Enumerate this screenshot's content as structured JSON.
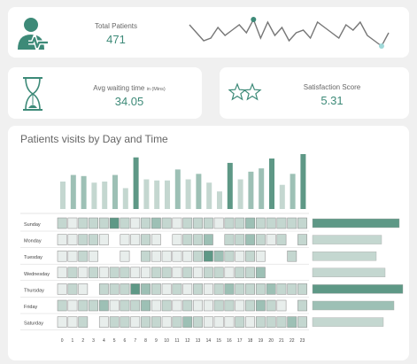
{
  "kpis": {
    "total": {
      "label": "Total Patients",
      "value": "471"
    },
    "wait": {
      "label": "Avg waiting time",
      "unit": "in (Mins)",
      "value": "34.05"
    },
    "sat": {
      "label": "Satisfaction Score",
      "value": "5.31"
    }
  },
  "trend": {
    "values": [
      8,
      5,
      2,
      3,
      7,
      4,
      6,
      8,
      5,
      10,
      3,
      9,
      4,
      7,
      2,
      5,
      6,
      3,
      9,
      7,
      5,
      3,
      8,
      6,
      9,
      4,
      2,
      0,
      5
    ]
  },
  "heatmap": {
    "title": "Patients visits by Day and Time",
    "days": [
      "Sunday",
      "Monday",
      "Tuesday",
      "Wednesday",
      "Thursday",
      "Friday",
      "Saturday"
    ],
    "hours": [
      "0",
      "1",
      "2",
      "3",
      "4",
      "5",
      "6",
      "7",
      "8",
      "9",
      "10",
      "11",
      "12",
      "13",
      "14",
      "15",
      "16",
      "17",
      "18",
      "19",
      "20",
      "21",
      "22",
      "23"
    ],
    "column_totals": [
      25,
      31,
      30,
      24,
      25,
      31,
      19,
      47,
      27,
      26,
      26,
      36,
      27,
      32,
      24,
      16,
      42,
      27,
      34,
      37,
      46,
      22,
      32,
      50
    ],
    "row_totals": [
      98,
      78,
      72,
      82,
      102,
      92,
      80
    ],
    "levels": [
      [
        2,
        1,
        2,
        2,
        2,
        4,
        2,
        1,
        2,
        3,
        2,
        1,
        2,
        2,
        2,
        1,
        2,
        2,
        3,
        2,
        2,
        2,
        2,
        2
      ],
      [
        1,
        1,
        2,
        2,
        1,
        -1,
        1,
        1,
        2,
        1,
        -1,
        1,
        2,
        2,
        3,
        -1,
        2,
        2,
        3,
        2,
        1,
        2,
        -1,
        2
      ],
      [
        1,
        1,
        2,
        1,
        -1,
        -1,
        1,
        -1,
        2,
        1,
        1,
        1,
        1,
        2,
        4,
        3,
        2,
        1,
        2,
        1,
        -1,
        -1,
        2,
        -1
      ],
      [
        1,
        2,
        1,
        2,
        1,
        2,
        2,
        1,
        1,
        2,
        2,
        1,
        2,
        1,
        2,
        2,
        1,
        2,
        2,
        3,
        -1,
        -1,
        -1,
        -1
      ],
      [
        1,
        2,
        1,
        -1,
        2,
        2,
        2,
        4,
        3,
        2,
        1,
        2,
        1,
        2,
        1,
        2,
        3,
        2,
        2,
        2,
        3,
        2,
        2,
        2
      ],
      [
        2,
        1,
        2,
        2,
        3,
        1,
        2,
        2,
        3,
        1,
        2,
        1,
        2,
        1,
        1,
        2,
        2,
        1,
        2,
        3,
        2,
        1,
        -1,
        2
      ],
      [
        1,
        1,
        2,
        -1,
        1,
        2,
        2,
        1,
        2,
        2,
        1,
        2,
        3,
        2,
        1,
        1,
        1,
        2,
        1,
        2,
        2,
        2,
        3,
        2
      ]
    ]
  },
  "icons": [
    "patient-icon",
    "hourglass-icon",
    "stars-icon"
  ],
  "colors": {
    "accent": "#3d8a78",
    "light": "#e8eeec",
    "dark": "#4f8f7e"
  }
}
